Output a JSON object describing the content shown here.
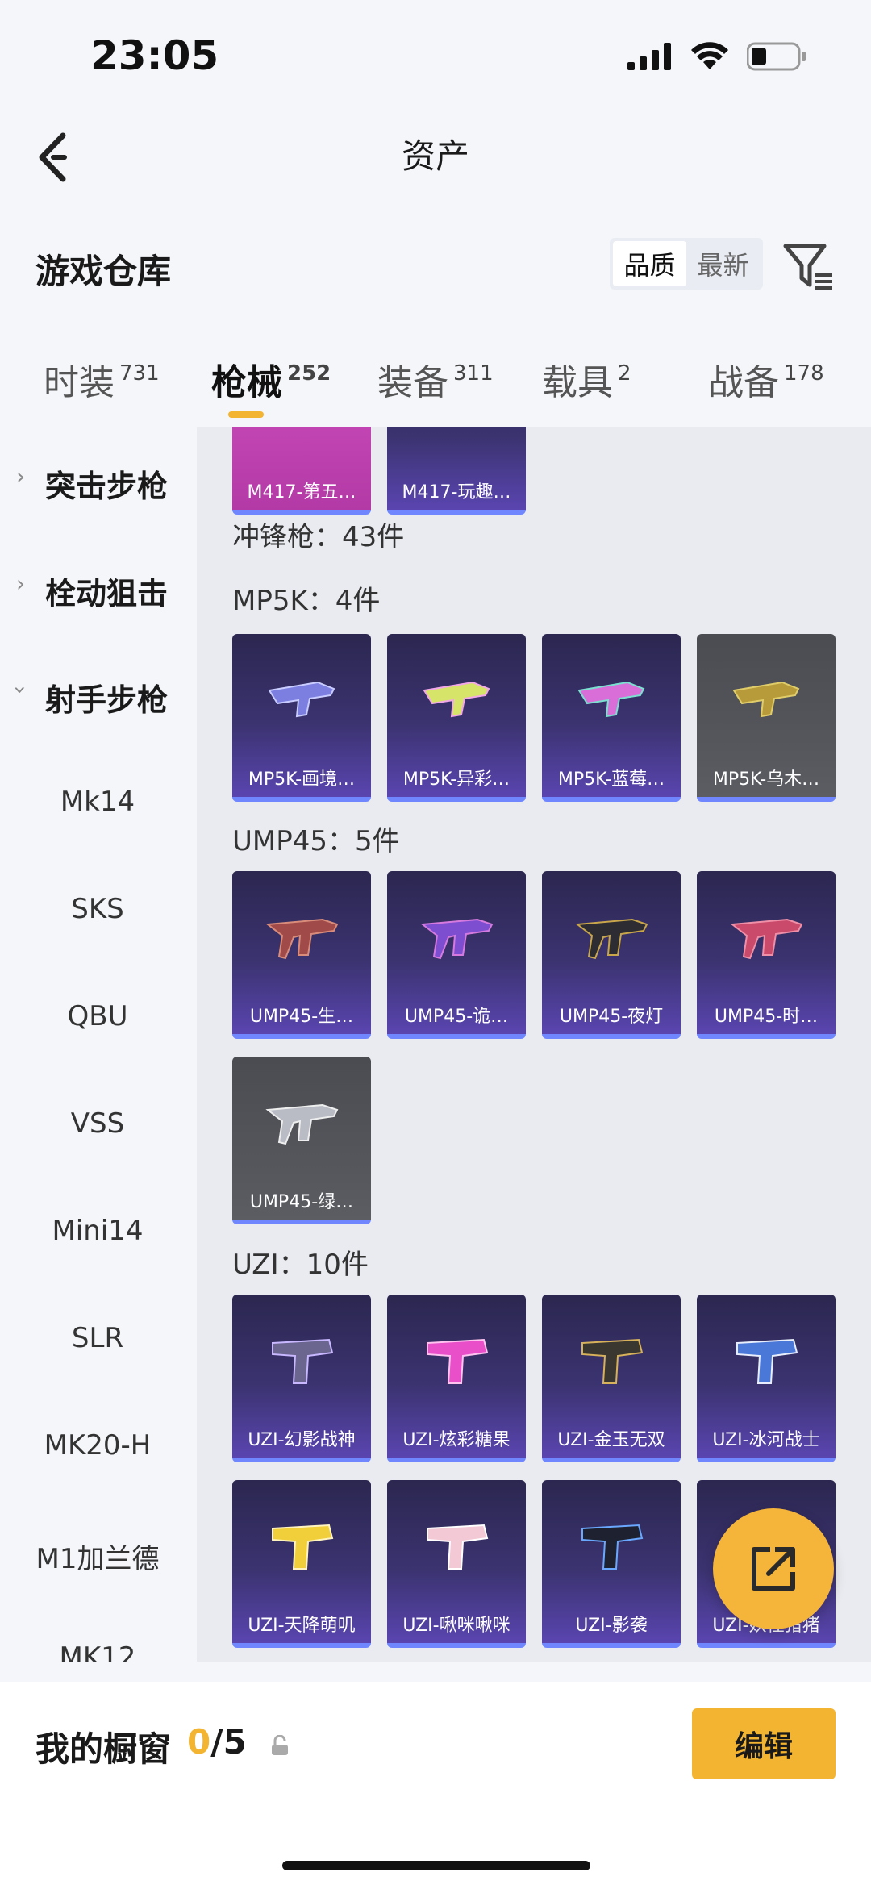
{
  "status": {
    "time": "23:05"
  },
  "nav": {
    "title": "资产"
  },
  "section": {
    "title": "游戏仓库",
    "sort_options": [
      "品质",
      "最新"
    ],
    "sort_active": "品质"
  },
  "tabs": [
    {
      "label": "时装",
      "count": "731"
    },
    {
      "label": "枪械",
      "count": "252"
    },
    {
      "label": "装备",
      "count": "311"
    },
    {
      "label": "载具",
      "count": "2"
    },
    {
      "label": "战备",
      "count": "178"
    }
  ],
  "sidebar": {
    "categories": [
      "突击步枪",
      "栓动狙击",
      "射手步枪"
    ],
    "subitems": [
      "Mk14",
      "SKS",
      "QBU",
      "VSS",
      "Mini14",
      "SLR",
      "MK20-H",
      "M1加兰德",
      "MK12"
    ]
  },
  "content": {
    "top_items": [
      "M417-第五…",
      "M417-玩趣…"
    ],
    "smg_label": "冲锋枪：43件",
    "groups": [
      {
        "label": "MP5K：4件",
        "items": [
          "MP5K-画境…",
          "MP5K-异彩…",
          "MP5K-蓝莓…",
          "MP5K-乌木…"
        ]
      },
      {
        "label": "UMP45：5件",
        "items": [
          "UMP45-生…",
          "UMP45-诡…",
          "UMP45-夜灯",
          "UMP45-时…",
          "UMP45-绿…"
        ]
      },
      {
        "label": "UZI：10件",
        "items": [
          "UZI-幻影战神",
          "UZI-炫彩糖果",
          "UZI-金玉无双",
          "UZI-冰河战士",
          "UZI-天降萌叽",
          "UZI-啾咪啾咪",
          "UZI-影袭",
          "UZI-妖怪猪猪"
        ]
      }
    ]
  },
  "bottom": {
    "showcase_label": "我的橱窗",
    "showcase_current": "0",
    "showcase_total": "/5",
    "edit_label": "编辑"
  },
  "colors": {
    "accent": "#f3b432",
    "item_purple": "#3b3370",
    "item_underline": "#6f86ff"
  }
}
